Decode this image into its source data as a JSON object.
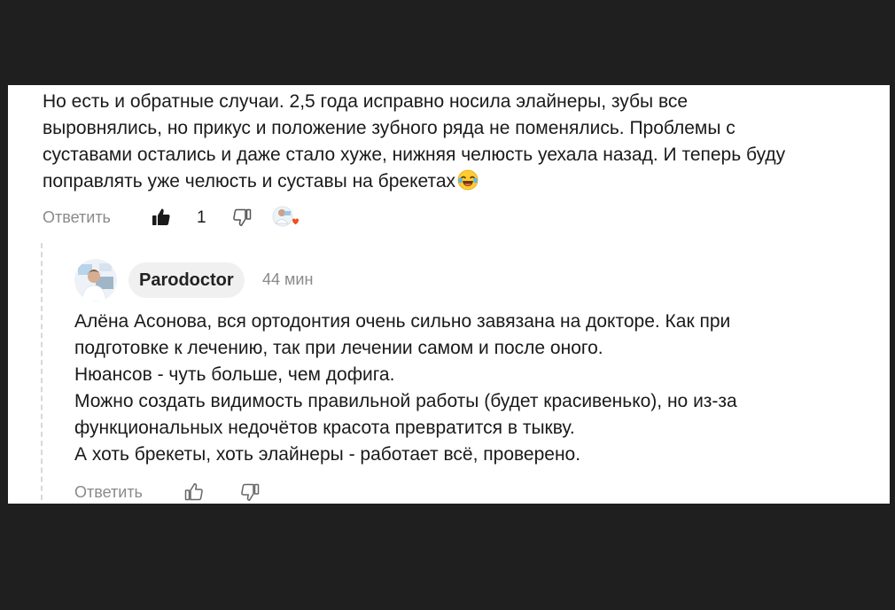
{
  "comment": {
    "lines": [
      "Но есть и обратные случаи. 2,5 года исправно носила элайнеры, зубы все",
      "выровнялись, но прикус и положение зубного ряда не поменялись. Проблемы с",
      "суставами остались и даже стало хуже, нижняя челюсть уехала назад. И теперь буду",
      "поправлять уже челюсть и суставы на брекетах"
    ],
    "emoji": "joy-emoji",
    "reply_label": "Ответить",
    "like_count": "1"
  },
  "reply": {
    "author": "Parodoctor",
    "time": "44 мин",
    "lines": [
      "Алёна Асонова, вся ортодонтия очень сильно завязана на докторе. Как при",
      "подготовке к лечению, так при лечении самом и после оного.",
      "Нюансов - чуть больше, чем дофига.",
      "Можно создать видимость правильной работы (будет красивенько), но из-за",
      "функциональных недочётов красота превратится в тыкву.",
      "А хоть брекеты, хоть элайнеры - работает всё, проверено."
    ],
    "reply_label": "Ответить"
  },
  "colors": {
    "background": "#1f1f1f",
    "panel": "#ffffff",
    "text": "#1a1a1a",
    "muted": "#8a8a8a",
    "chip": "#f0f0f0",
    "heart": "#f24e1e"
  }
}
